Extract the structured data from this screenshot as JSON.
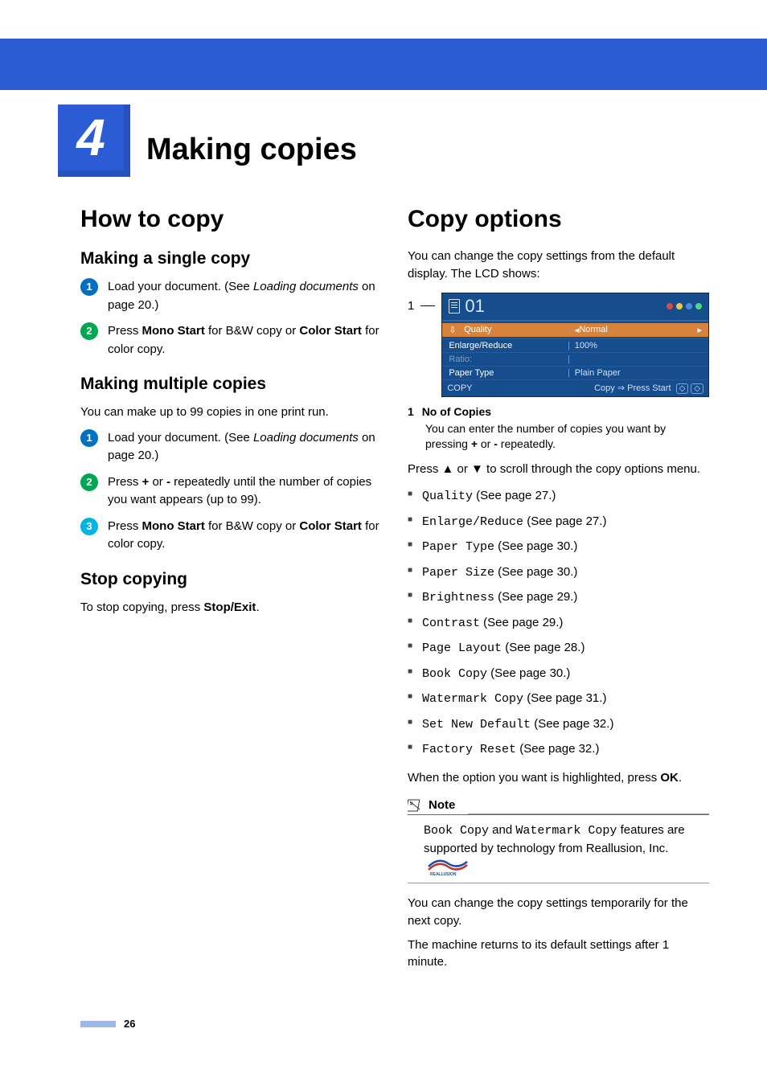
{
  "chapter": {
    "number": "4",
    "title": "Making copies"
  },
  "page_number": "26",
  "left": {
    "heading": "How to copy",
    "sub1": {
      "title": "Making a single copy",
      "steps": [
        {
          "pre": "Load your document.\n(See ",
          "link": "Loading documents",
          "post": " on page 20.)"
        },
        {
          "pre": "Press ",
          "b1": "Mono Start",
          "mid": " for B&W copy or ",
          "b2": "Color Start",
          "post": " for color copy."
        }
      ]
    },
    "sub2": {
      "title": "Making multiple copies",
      "intro": "You can make up to 99 copies in one print run.",
      "steps": [
        {
          "pre": "Load your document.\n(See ",
          "link": "Loading documents",
          "post": " on page 20.)"
        },
        {
          "pre": "Press ",
          "b1": "+",
          "mid": " or ",
          "b2": "-",
          "post": " repeatedly until the number of copies you want appears (up to 99)."
        },
        {
          "pre": "Press ",
          "b1": "Mono Start",
          "mid": " for B&W copy or ",
          "b2": "Color Start",
          "post": " for color copy."
        }
      ]
    },
    "sub3": {
      "title": "Stop copying",
      "body_pre": "To stop copying, press ",
      "body_b": "Stop/Exit",
      "body_post": "."
    }
  },
  "right": {
    "heading": "Copy options",
    "intro": "You can change the copy settings from the default display. The LCD shows:",
    "lcd": {
      "callout_num": "1",
      "copies": "01",
      "rows": [
        {
          "label": "Quality",
          "value": "Normal",
          "highlight": true,
          "arrows": true
        },
        {
          "label": "Enlarge/Reduce",
          "value": "100%"
        },
        {
          "label": "Ratio:",
          "value": ""
        },
        {
          "label": "Paper Type",
          "value": "Plain Paper"
        }
      ],
      "footer_left": "COPY",
      "footer_right": "Copy ⇒ Press Start"
    },
    "legend": {
      "num": "1",
      "title": "No of Copies",
      "sub_pre": "You can enter the number of copies you want by pressing ",
      "sub_b1": "+",
      "sub_mid": " or ",
      "sub_b2": "-",
      "sub_post": " repeatedly."
    },
    "scroll_hint": "Press ▲ or ▼ to scroll through the copy options menu.",
    "options": [
      {
        "mono": "Quality",
        "page": " (See page 27.)"
      },
      {
        "mono": "Enlarge/Reduce",
        "page": " (See page 27.)"
      },
      {
        "mono": "Paper Type",
        "page": " (See page 30.)"
      },
      {
        "mono": "Paper Size",
        "page": " (See page 30.)"
      },
      {
        "mono": "Brightness",
        "page": " (See page 29.)"
      },
      {
        "mono": "Contrast",
        "page": " (See page 29.)"
      },
      {
        "mono": "Page Layout",
        "page": " (See page 28.)"
      },
      {
        "mono": "Book Copy",
        "page": " (See page 30.)"
      },
      {
        "mono": "Watermark Copy",
        "page": " (See page 31.)"
      },
      {
        "mono": "Set New Default",
        "page": " (See page 32.)"
      },
      {
        "mono": "Factory Reset",
        "page": " (See page 32.)"
      }
    ],
    "press_ok_pre": "When the option you want is highlighted, press ",
    "press_ok_b": "OK",
    "press_ok_post": ".",
    "note": {
      "label": "Note",
      "body_m1": "Book Copy",
      "body_mid1": " and ",
      "body_m2": "Watermark Copy",
      "body_mid2": " features are supported by technology from Reallusion, Inc. "
    },
    "temp": "You can change the copy settings temporarily for the next copy.",
    "return": "The machine returns to its default settings after 1 minute."
  }
}
